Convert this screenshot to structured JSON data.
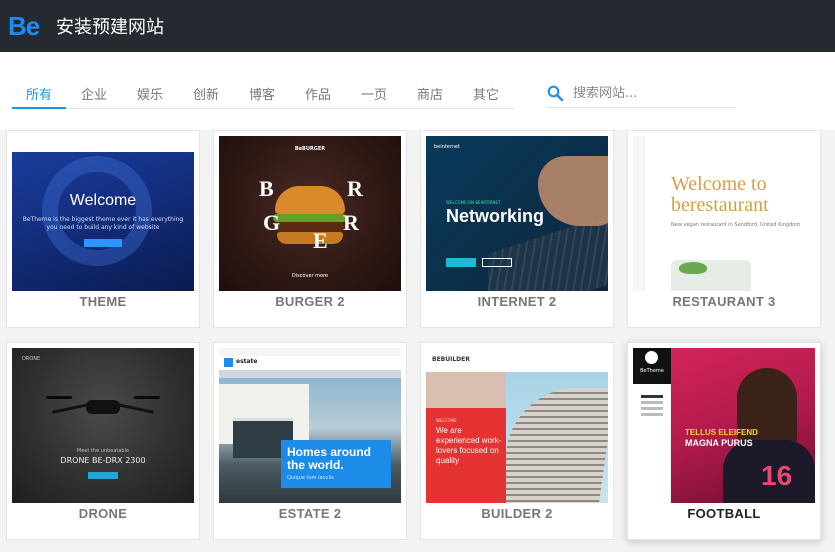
{
  "header": {
    "logo": "Be",
    "title": "安装预建网站"
  },
  "filters": {
    "tabs": [
      {
        "label": "所有",
        "active": true
      },
      {
        "label": "企业"
      },
      {
        "label": "娱乐"
      },
      {
        "label": "创新"
      },
      {
        "label": "博客"
      },
      {
        "label": "作品"
      },
      {
        "label": "一页"
      },
      {
        "label": "商店"
      },
      {
        "label": "其它"
      }
    ],
    "search": {
      "placeholder": "搜索网站..."
    }
  },
  "sites": [
    {
      "name": "THEME",
      "thumb": {
        "headline": "Welcome",
        "tagline": "BeTheme is the biggest theme ever\nit has everything you need to build any kind of website"
      }
    },
    {
      "name": "BURGER 2",
      "thumb": {
        "nav": "BeBURGER",
        "letters": "B  R  G  E  R",
        "footer": "Discover more"
      }
    },
    {
      "name": "INTERNET 2",
      "thumb": {
        "nav": "beinternet",
        "kicker": "WELCOME ON BEINTERNET",
        "headline": "Networking"
      }
    },
    {
      "name": "RESTAURANT 3",
      "thumb": {
        "headline": "Welcome to berestaurant",
        "tagline": "New vegan restaurant in Sandford, United Kingdom"
      }
    },
    {
      "name": "DRONE",
      "thumb": {
        "nav": "DRONE",
        "kicker": "Meet the unbeatable",
        "headline": "DRONE BE-DRX 2300"
      }
    },
    {
      "name": "ESTATE 2",
      "thumb": {
        "brand": "estate",
        "headline": "Homes around the world.",
        "tagline": "Quique tum iaculis"
      }
    },
    {
      "name": "BUILDER 2",
      "thumb": {
        "brand": "BEBUILDER",
        "kicker": "WELCOME",
        "headline": "We are experienced work-lovers focused on quality"
      }
    },
    {
      "name": "FOOTBALL",
      "selected": true,
      "thumb": {
        "brand": "BeTheme",
        "kicker": "TELLUS ELEIFEND",
        "headline": "MAGNA PURUS",
        "number": "16"
      }
    }
  ],
  "colors": {
    "header_bg": "#252a31",
    "accent": "#2196e0",
    "brand": "#1c8cf0"
  }
}
